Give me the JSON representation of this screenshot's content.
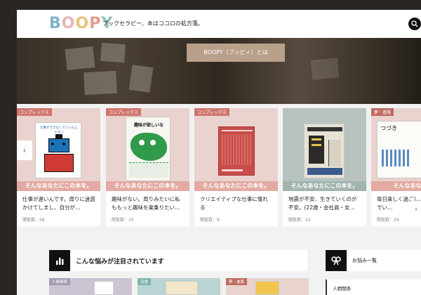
{
  "header": {
    "logo_letters": [
      "B",
      "O",
      "O",
      "P",
      "Y"
    ],
    "logo_colors": [
      "#7fb5c6",
      "#e8b5b5",
      "#e8c47a",
      "#e79a8c",
      "#8fc2b4"
    ],
    "tagline": "ブックセラピー、本はココロの処方箋。"
  },
  "hero": {
    "button_label": "BOOPY（ブッピィ）とは"
  },
  "carousel": {
    "prev_label": "‹",
    "next_label": "›",
    "cards": [
      {
        "tag": "コンプレックス",
        "bg": "#ead2ce",
        "banner_color": "#e3aaa2",
        "banner": "そんなあなたにこの本を。",
        "text": "仕事が遅いんです。周りに迷惑かけてしまし、自分が…",
        "views": "閲覧数：58",
        "book_title": "仕事ができなくていいんじゃない"
      },
      {
        "tag": "コンプレックス",
        "bg": "#ead2ce",
        "banner_color": "#e3aaa2",
        "banner": "そんなあなたにこの本を。",
        "text": "趣味がない。周りみたいに私ももっと趣味を楽乗りたい…",
        "views": "閲覧数：35",
        "book_title": "趣味が欲しいな"
      },
      {
        "tag": "コンプレックス",
        "bg": "#ead2ce",
        "banner_color": "#e3aaa2",
        "banner": "そんなあなたにこの本を。",
        "text": "クリエイティブな仕事に憧れる",
        "views": "閲覧数：9",
        "book_title": ""
      },
      {
        "tag": "",
        "bg": "#b8c3bf",
        "banner_color": "#a3b4b0",
        "banner": "そんなあなたにこの本を。",
        "text": "地震が不安、生きていくのが不安。(22歳・会社員・女…",
        "views": "閲覧数：42",
        "book_title": ""
      },
      {
        "tag": "夢・進路",
        "bg": "#ead2ce",
        "banner_color": "#e3aaa2",
        "banner": "そんなあなたに",
        "text": "毎日楽しく過ごし、このままでい…",
        "views": "閲覧数：29",
        "book_title": "つづき"
      }
    ]
  },
  "section": {
    "title": "こんな悩みが注目されています",
    "sidebar_title": "お悩み一覧",
    "sidebar_item": "人間関係",
    "small_tags": [
      "人間関係",
      "日常",
      "夢・進路"
    ]
  },
  "icons": {
    "search": "search-icon",
    "chart": "bar-chart-icon",
    "ribbon": "ribbon-icon"
  }
}
